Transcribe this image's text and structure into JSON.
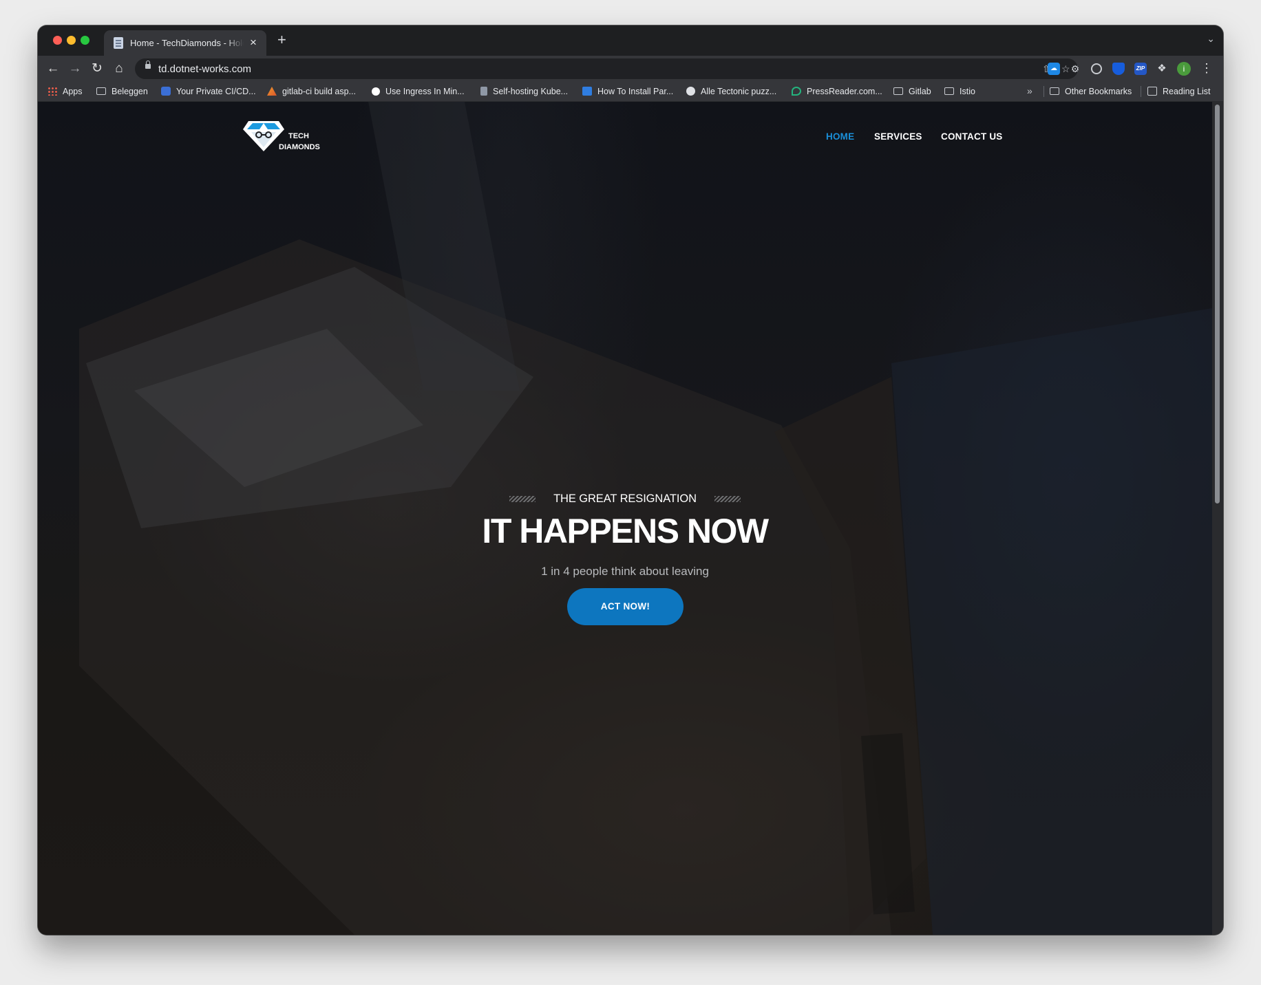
{
  "browser": {
    "tab": {
      "title": "Home - TechDiamonds - Hold on to your Tech Talent"
    },
    "new_tab_label": "+",
    "close_label": "×",
    "tab_menu_label": "⌄",
    "address": {
      "url": "td.dotnet-works.com"
    },
    "profile_initial": "i",
    "icons": [
      "back-arrow-icon",
      "forward-arrow-icon",
      "reload-icon",
      "home-icon",
      "lock-icon",
      "share-icon",
      "star-icon",
      "onedrive-icon",
      "gear-icon",
      "target-icon",
      "bitwarden-icon",
      "zip-icon",
      "puzzle-icon",
      "more-icon"
    ]
  },
  "bookmarks": {
    "items": [
      {
        "label": "Apps",
        "icon": "apps-grid-icon"
      },
      {
        "label": "Beleggen",
        "icon": "folder-icon"
      },
      {
        "label": "Your Private CI/CD...",
        "icon": "cicd-icon"
      },
      {
        "label": "gitlab-ci build asp...",
        "icon": "stackoverflow-icon"
      },
      {
        "label": "Use Ingress In Min...",
        "icon": "medium-icon"
      },
      {
        "label": "Self-hosting Kube...",
        "icon": "kube-icon"
      },
      {
        "label": "How To Install Par...",
        "icon": "edu-icon"
      },
      {
        "label": "Alle Tectonic puzz...",
        "icon": "globe-icon"
      },
      {
        "label": "PressReader.com...",
        "icon": "pressreader-icon"
      },
      {
        "label": "Gitlab",
        "icon": "folder-icon"
      },
      {
        "label": "Istio",
        "icon": "folder-icon"
      }
    ],
    "more_label": "»",
    "other_label": "Other Bookmarks",
    "reading_list_label": "Reading List"
  },
  "site": {
    "logo": {
      "line1": "TECH",
      "line2": "DIAMONDS",
      "icon": "diamond-logo-icon"
    },
    "nav": {
      "home": "HOME",
      "services": "SERVICES",
      "contact": "CONTACT US"
    },
    "hero": {
      "kicker": "THE GREAT RESIGNATION",
      "title": "IT HAPPENS NOW",
      "subtitle": "1 in 4 people think about leaving",
      "cta": "ACT NOW!"
    }
  },
  "colors": {
    "accent": "#0d76bf",
    "nav_active": "#1a8fd8",
    "page_background": "#16171b"
  }
}
